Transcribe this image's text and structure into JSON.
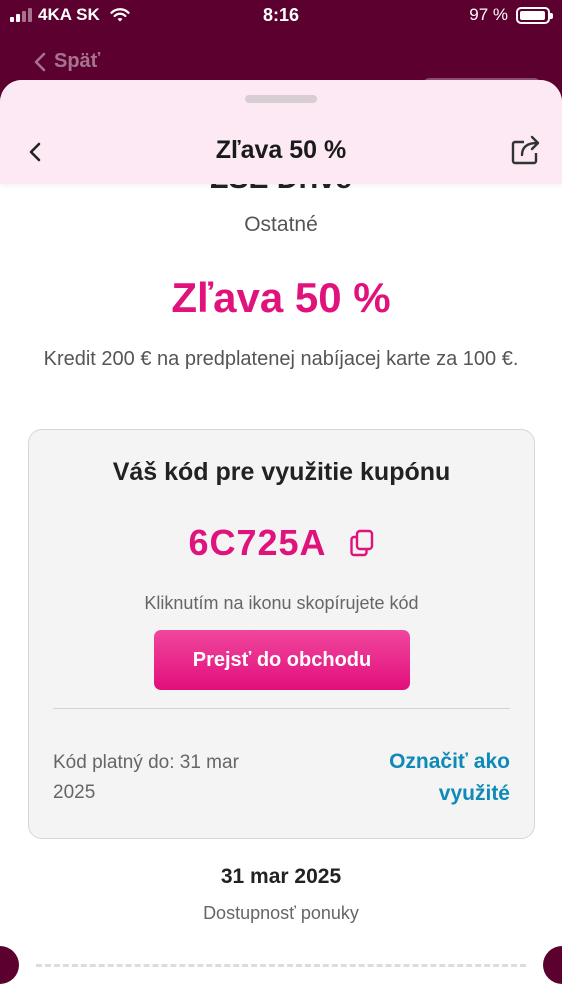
{
  "status": {
    "carrier": "4KA SK",
    "time": "8:16",
    "battery": "97 %",
    "battery_level_fraction": 0.97
  },
  "behind": {
    "back_label": "Späť"
  },
  "header": {
    "title": "Zľava 50 %"
  },
  "offer": {
    "partner_partial": "ZSE Drive",
    "category": "Ostatné",
    "discount": "Zľava 50 %",
    "description": "Kredit 200 € na predplatenej nabíjacej karte za 100 €."
  },
  "coupon": {
    "title": "Váš kód pre využitie kupónu",
    "code": "6C725A",
    "copy_hint": "Kliknutím na ikonu skopírujete kód",
    "shop_button": "Prejsť do obchodu",
    "valid_until": "Kód platný do: 31 mar 2025",
    "mark_used": "Označiť ako využité"
  },
  "availability": {
    "date": "31 mar 2025",
    "label": "Dostupnosť ponuky"
  },
  "colors": {
    "accent": "#e0127c",
    "link": "#0f8ab8",
    "brand_dark": "#5c0030",
    "header_bg": "#fce9f3"
  },
  "icons": [
    "signal-icon",
    "wifi-icon",
    "battery-icon",
    "chevron-left-icon",
    "share-icon",
    "copy-icon"
  ]
}
